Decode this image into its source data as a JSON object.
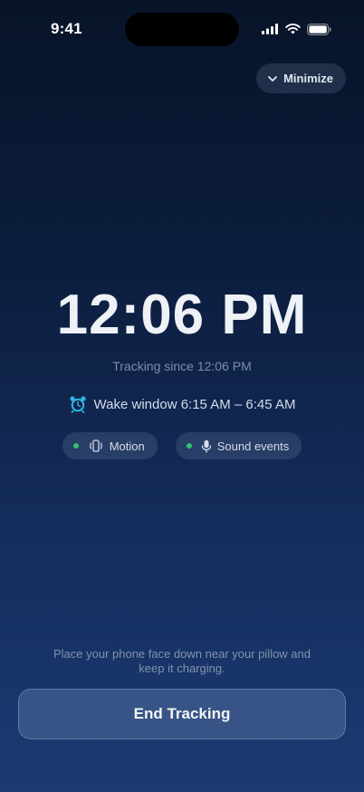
{
  "status_bar": {
    "time": "9:41",
    "signal_icon": "cellular-signal-icon",
    "wifi_icon": "wifi-icon",
    "battery_icon": "battery-icon"
  },
  "header": {
    "minimize_label": "Minimize",
    "minimize_icon": "chevron-down-icon"
  },
  "tracking": {
    "current_time": "12:06 PM",
    "since_text": "Tracking since 12:06 PM",
    "wake_window_icon": "alarm-clock-icon",
    "wake_window_text": "Wake window 6:15 AM – 6:45 AM"
  },
  "sensors": [
    {
      "label": "Motion",
      "icon": "phone-vibrate-icon",
      "status_color": "#33c46b"
    },
    {
      "label": "Sound events",
      "icon": "microphone-icon",
      "status_color": "#33c46b"
    }
  ],
  "footer": {
    "hint": "Place your phone face down near your pillow and keep it charging.",
    "end_button_label": "End Tracking"
  },
  "colors": {
    "background_top": "#071429",
    "background_bottom": "#1c3a73",
    "accent_alarm": "#2fb6e0",
    "active_dot": "#33c46b"
  }
}
